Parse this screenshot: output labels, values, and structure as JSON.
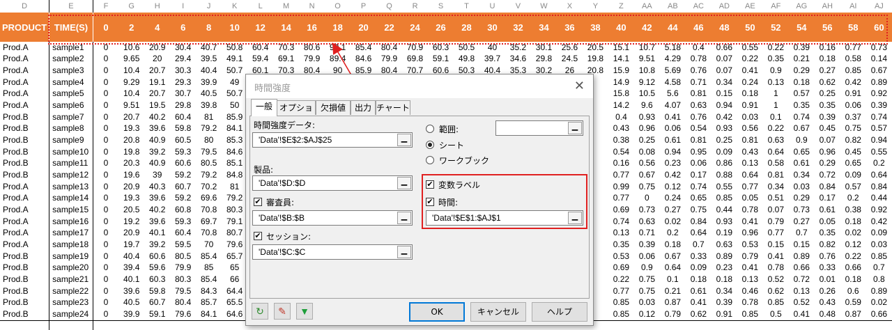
{
  "columns": [
    "D",
    "E",
    "F",
    "G",
    "H",
    "I",
    "J",
    "K",
    "L",
    "M",
    "N",
    "O",
    "P",
    "Q",
    "R",
    "S",
    "T",
    "U",
    "V",
    "W",
    "X",
    "Y",
    "Z",
    "AA",
    "AB",
    "AC",
    "AD",
    "AE",
    "AF",
    "AG",
    "AH",
    "AI",
    "AJ"
  ],
  "header_row": [
    "PRODUCT",
    "TIME(S)",
    "0",
    "2",
    "4",
    "6",
    "8",
    "10",
    "12",
    "14",
    "16",
    "18",
    "20",
    "22",
    "24",
    "26",
    "28",
    "30",
    "32",
    "34",
    "36",
    "38",
    "40",
    "42",
    "44",
    "46",
    "48",
    "50",
    "52",
    "54",
    "56",
    "58",
    "60"
  ],
  "rows": [
    [
      "Prod.A",
      "sample1",
      "0",
      "10.6",
      "20.9",
      "30.4",
      "40.7",
      "50.8",
      "60.4",
      "70.3",
      "80.6",
      "90.1",
      "85.4",
      "80.4",
      "70.9",
      "60.3",
      "50.5",
      "40",
      "35.2",
      "30.1",
      "25.6",
      "20.5",
      "15.1",
      "10.7",
      "5.18",
      "0.4",
      "0.66",
      "0.55",
      "0.22",
      "0.39",
      "0.16",
      "0.77",
      "0.73"
    ],
    [
      "Prod.A",
      "sample2",
      "0",
      "9.65",
      "20",
      "29.4",
      "39.5",
      "49.1",
      "59.4",
      "69.1",
      "79.9",
      "89.4",
      "84.6",
      "79.9",
      "69.8",
      "59.1",
      "49.8",
      "39.7",
      "34.6",
      "29.8",
      "24.5",
      "19.8",
      "14.1",
      "9.51",
      "4.29",
      "0.78",
      "0.07",
      "0.22",
      "0.35",
      "0.21",
      "0.18",
      "0.58",
      "0.14"
    ],
    [
      "Prod.A",
      "sample3",
      "0",
      "10.4",
      "20.7",
      "30.3",
      "40.4",
      "50.7",
      "60.1",
      "70.3",
      "80.4",
      "90",
      "85.9",
      "80.4",
      "70.7",
      "60.6",
      "50.3",
      "40.4",
      "35.3",
      "30.2",
      "26",
      "20.8",
      "15.9",
      "10.8",
      "5.69",
      "0.76",
      "0.07",
      "0.41",
      "0.9",
      "0.29",
      "0.27",
      "0.85",
      "0.67"
    ],
    [
      "Prod.A",
      "sample4",
      "0",
      "9.29",
      "19.1",
      "29.3",
      "39.9",
      "49",
      "",
      "",
      "",
      "",
      "",
      "",
      "",
      "",
      "",
      "",
      "",
      "",
      "",
      "",
      "14.9",
      "9.12",
      "4.58",
      "0.71",
      "0.34",
      "0.24",
      "0.13",
      "0.18",
      "0.62",
      "0.42",
      "0.89"
    ],
    [
      "Prod.A",
      "sample5",
      "0",
      "10.4",
      "20.7",
      "30.7",
      "40.5",
      "50.7",
      "",
      "",
      "",
      "",
      "",
      "",
      "",
      "",
      "",
      "",
      "",
      "",
      "",
      "",
      "15.8",
      "10.5",
      "5.6",
      "0.81",
      "0.15",
      "0.18",
      "1",
      "0.57",
      "0.25",
      "0.91",
      "0.92"
    ],
    [
      "Prod.A",
      "sample6",
      "0",
      "9.51",
      "19.5",
      "29.8",
      "39.8",
      "50",
      "",
      "",
      "",
      "",
      "",
      "",
      "",
      "",
      "",
      "",
      "",
      "",
      "",
      "",
      "14.2",
      "9.6",
      "4.07",
      "0.63",
      "0.94",
      "0.91",
      "1",
      "0.35",
      "0.35",
      "0.06",
      "0.39"
    ],
    [
      "Prod.B",
      "sample7",
      "0",
      "20.7",
      "40.2",
      "60.4",
      "81",
      "85.9",
      "",
      "",
      "",
      "",
      "",
      "",
      "",
      "",
      "",
      "",
      "",
      "",
      "",
      "",
      "0.4",
      "0.93",
      "0.41",
      "0.76",
      "0.42",
      "0.03",
      "0.1",
      "0.74",
      "0.39",
      "0.37",
      "0.74"
    ],
    [
      "Prod.B",
      "sample8",
      "0",
      "19.3",
      "39.6",
      "59.8",
      "79.2",
      "84.1",
      "",
      "",
      "",
      "",
      "",
      "",
      "",
      "",
      "",
      "",
      "",
      "",
      "",
      "",
      "0.43",
      "0.96",
      "0.06",
      "0.54",
      "0.93",
      "0.56",
      "0.22",
      "0.67",
      "0.45",
      "0.75",
      "0.57"
    ],
    [
      "Prod.B",
      "sample9",
      "0",
      "20.8",
      "40.9",
      "60.5",
      "80",
      "85.3",
      "",
      "",
      "",
      "",
      "",
      "",
      "",
      "",
      "",
      "",
      "",
      "",
      "",
      "",
      "0.38",
      "0.25",
      "0.61",
      "0.81",
      "0.25",
      "0.81",
      "0.63",
      "0.9",
      "0.07",
      "0.82",
      "0.94"
    ],
    [
      "Prod.B",
      "sample10",
      "0",
      "19.8",
      "39.2",
      "59.3",
      "79.5",
      "84.6",
      "",
      "",
      "",
      "",
      "",
      "",
      "",
      "",
      "",
      "",
      "",
      "",
      "",
      "",
      "0.54",
      "0.08",
      "0.94",
      "0.95",
      "0.09",
      "0.43",
      "0.64",
      "0.65",
      "0.96",
      "0.45",
      "0.55"
    ],
    [
      "Prod.B",
      "sample11",
      "0",
      "20.3",
      "40.9",
      "60.6",
      "80.5",
      "85.1",
      "",
      "",
      "",
      "",
      "",
      "",
      "",
      "",
      "",
      "",
      "",
      "",
      "",
      "",
      "0.16",
      "0.56",
      "0.23",
      "0.06",
      "0.86",
      "0.13",
      "0.58",
      "0.61",
      "0.29",
      "0.65",
      "0.2"
    ],
    [
      "Prod.B",
      "sample12",
      "0",
      "19.6",
      "39",
      "59.2",
      "79.2",
      "84.8",
      "",
      "",
      "",
      "",
      "",
      "",
      "",
      "",
      "",
      "",
      "",
      "",
      "",
      "",
      "0.77",
      "0.67",
      "0.42",
      "0.17",
      "0.88",
      "0.64",
      "0.81",
      "0.34",
      "0.72",
      "0.09",
      "0.64"
    ],
    [
      "Prod.A",
      "sample13",
      "0",
      "20.9",
      "40.3",
      "60.7",
      "70.2",
      "81",
      "",
      "",
      "",
      "",
      "",
      "",
      "",
      "",
      "",
      "",
      "",
      "",
      "",
      "",
      "0.99",
      "0.75",
      "0.12",
      "0.74",
      "0.55",
      "0.77",
      "0.34",
      "0.03",
      "0.84",
      "0.57",
      "0.84"
    ],
    [
      "Prod.A",
      "sample14",
      "0",
      "19.3",
      "39.6",
      "59.2",
      "69.6",
      "79.2",
      "",
      "",
      "",
      "",
      "",
      "",
      "",
      "",
      "",
      "",
      "",
      "",
      "",
      "",
      "0.77",
      "0",
      "0.24",
      "0.65",
      "0.85",
      "0.05",
      "0.51",
      "0.29",
      "0.17",
      "0.2",
      "0.44"
    ],
    [
      "Prod.A",
      "sample15",
      "0",
      "20.5",
      "40.2",
      "60.8",
      "70.8",
      "80.3",
      "",
      "",
      "",
      "",
      "",
      "",
      "",
      "",
      "",
      "",
      "",
      "",
      "",
      "",
      "0.69",
      "0.73",
      "0.27",
      "0.75",
      "0.44",
      "0.78",
      "0.07",
      "0.73",
      "0.61",
      "0.38",
      "0.92"
    ],
    [
      "Prod.A",
      "sample16",
      "0",
      "19.2",
      "39.6",
      "59.3",
      "69.7",
      "79.1",
      "",
      "",
      "",
      "",
      "",
      "",
      "",
      "",
      "",
      "",
      "",
      "",
      "",
      "",
      "0.74",
      "0.63",
      "0.02",
      "0.84",
      "0.93",
      "0.41",
      "0.79",
      "0.27",
      "0.05",
      "0.18",
      "0.42"
    ],
    [
      "Prod.A",
      "sample17",
      "0",
      "20.9",
      "40.1",
      "60.4",
      "70.8",
      "80.7",
      "",
      "",
      "",
      "",
      "",
      "",
      "",
      "",
      "",
      "",
      "",
      "",
      "",
      "",
      "0.13",
      "0.71",
      "0.2",
      "0.64",
      "0.19",
      "0.96",
      "0.77",
      "0.7",
      "0.35",
      "0.02",
      "0.09"
    ],
    [
      "Prod.A",
      "sample18",
      "0",
      "19.7",
      "39.2",
      "59.5",
      "70",
      "79.6",
      "",
      "",
      "",
      "",
      "",
      "",
      "",
      "",
      "",
      "",
      "",
      "",
      "",
      "",
      "0.35",
      "0.39",
      "0.18",
      "0.7",
      "0.63",
      "0.53",
      "0.15",
      "0.15",
      "0.82",
      "0.12",
      "0.03"
    ],
    [
      "Prod.B",
      "sample19",
      "0",
      "40.4",
      "60.6",
      "80.5",
      "85.4",
      "65.7",
      "",
      "",
      "",
      "",
      "",
      "",
      "",
      "",
      "",
      "",
      "",
      "",
      "",
      "",
      "0.53",
      "0.06",
      "0.67",
      "0.33",
      "0.89",
      "0.79",
      "0.41",
      "0.89",
      "0.76",
      "0.22",
      "0.85"
    ],
    [
      "Prod.B",
      "sample20",
      "0",
      "39.4",
      "59.6",
      "79.9",
      "85",
      "65",
      "",
      "",
      "",
      "",
      "",
      "",
      "",
      "",
      "",
      "",
      "",
      "",
      "",
      "",
      "0.69",
      "0.9",
      "0.64",
      "0.09",
      "0.23",
      "0.41",
      "0.78",
      "0.66",
      "0.33",
      "0.66",
      "0.7"
    ],
    [
      "Prod.B",
      "sample21",
      "0",
      "40.1",
      "60.3",
      "80.3",
      "85.4",
      "66",
      "",
      "",
      "",
      "",
      "",
      "",
      "",
      "",
      "",
      "",
      "",
      "",
      "",
      "",
      "0.22",
      "0.75",
      "0.1",
      "0.18",
      "0.18",
      "0.13",
      "0.52",
      "0.72",
      "0.01",
      "0.18",
      "0.8"
    ],
    [
      "Prod.B",
      "sample22",
      "0",
      "39.6",
      "59.8",
      "79.5",
      "84.3",
      "64.4",
      "",
      "",
      "",
      "",
      "",
      "",
      "",
      "",
      "",
      "",
      "",
      "",
      "",
      "",
      "0.77",
      "0.75",
      "0.21",
      "0.61",
      "0.34",
      "0.46",
      "0.62",
      "0.13",
      "0.26",
      "0.6",
      "0.89"
    ],
    [
      "Prod.B",
      "sample23",
      "0",
      "40.5",
      "60.7",
      "80.4",
      "85.7",
      "65.5",
      "",
      "",
      "",
      "",
      "",
      "",
      "",
      "",
      "",
      "",
      "",
      "",
      "",
      "",
      "0.85",
      "0.03",
      "0.87",
      "0.41",
      "0.39",
      "0.78",
      "0.85",
      "0.52",
      "0.43",
      "0.59",
      "0.02"
    ],
    [
      "Prod.B",
      "sample24",
      "0",
      "39.9",
      "59.1",
      "79.6",
      "84.1",
      "64.6",
      "",
      "",
      "",
      "",
      "",
      "",
      "",
      "",
      "",
      "",
      "",
      "",
      "",
      "",
      "0.85",
      "0.12",
      "0.79",
      "0.62",
      "0.91",
      "0.85",
      "0.5",
      "0.41",
      "0.48",
      "0.87",
      "0.66"
    ]
  ],
  "dialog": {
    "title": "時間強度",
    "close_glyph": "✕",
    "tabs": [
      "一般",
      "オプション",
      "欠損値",
      "出力",
      "チャート"
    ],
    "data_label": "時間強度データ:",
    "data_value": "'Data'!$E$2:$AJ$25",
    "product_label": "製品:",
    "product_value": "'Data'!$D:$D",
    "assessor_label": "審査員:",
    "assessor_value": "'Data'!$B:$B",
    "assessor_checked": true,
    "session_label": "セッション:",
    "session_value": "'Data'!$C:$C",
    "session_checked": true,
    "range_label": "範囲:",
    "range_value": "",
    "sheet_label": "シート",
    "workbook_label": "ワークブック",
    "selected_output": "sheet",
    "var_labels_label": "変数ラベル",
    "var_labels_checked": true,
    "time_label": "時間:",
    "time_checked": true,
    "time_value": "'Data'!$E$1:$AJ$1",
    "picker_glyph": "▁",
    "check_glyph": "✔",
    "ok_label": "OK",
    "cancel_label": "キャンセル",
    "help_label": "ヘルプ",
    "reset_glyph": "↻",
    "eraser_glyph": "✎",
    "down_glyph": "▼"
  },
  "colors": {
    "header": "#ed7d31",
    "highlight": "#e02020",
    "reset_icon": "#2e8b2e",
    "eraser_icon": "#c0392b",
    "down_icon": "#1e9e3a"
  }
}
